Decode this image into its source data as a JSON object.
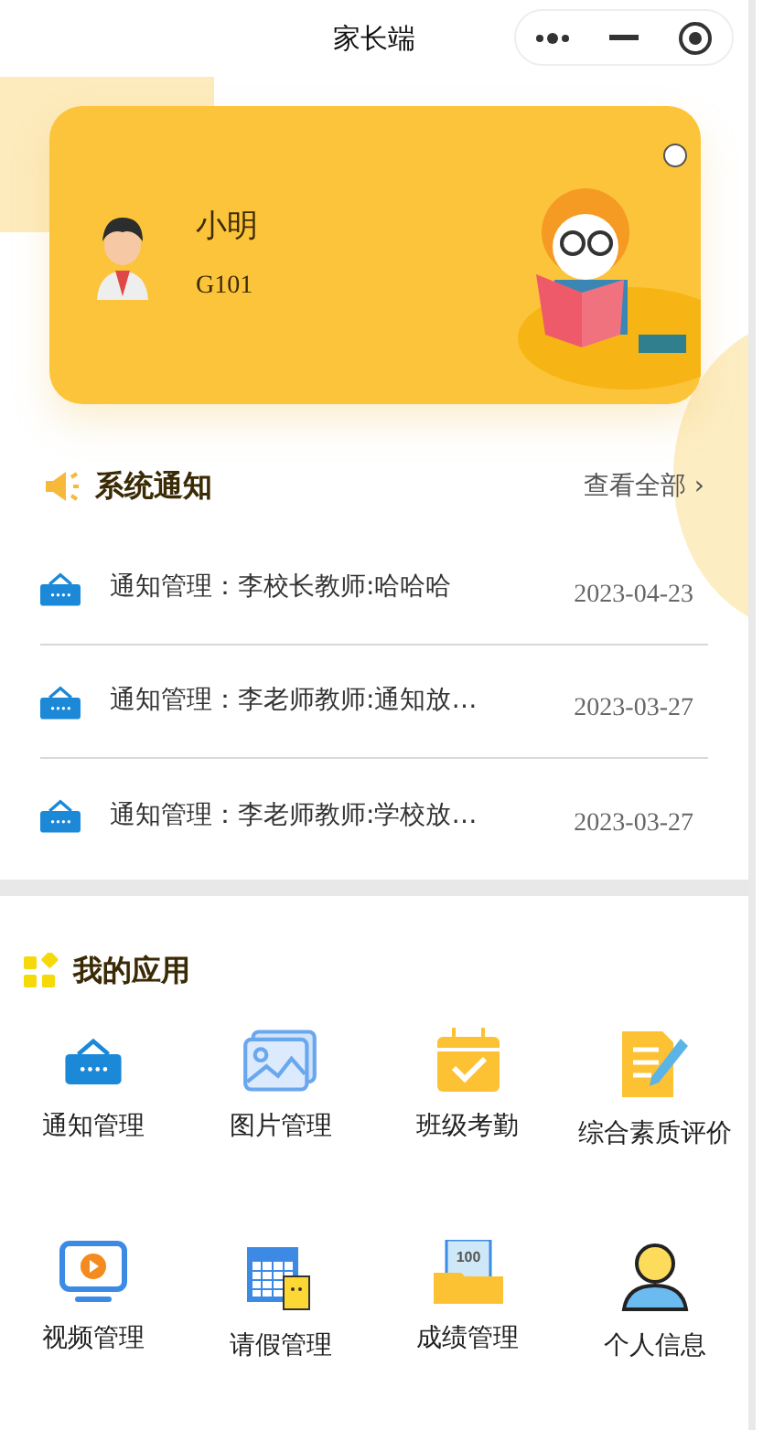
{
  "title_bar": {
    "title": "家长端"
  },
  "profile": {
    "name": "小明",
    "class_code": "G101"
  },
  "notices": {
    "title": "系统通知",
    "view_all": "查看全部",
    "chevron": "›",
    "items": [
      {
        "text": "通知管理：李校长教师:哈哈哈",
        "date": "2023-04-23"
      },
      {
        "text": "通知管理：李老师教师:通知放…",
        "date": "2023-03-27"
      },
      {
        "text": "通知管理：李老师教师:学校放…",
        "date": "2023-03-27"
      }
    ]
  },
  "apps": {
    "title": "我的应用",
    "items": [
      {
        "kind": "notice",
        "label": "通知管理"
      },
      {
        "kind": "picture",
        "label": "图片管理"
      },
      {
        "kind": "attendance",
        "label": "班级考勤"
      },
      {
        "kind": "evaluation",
        "label": "综合素质评价"
      },
      {
        "kind": "video",
        "label": "视频管理"
      },
      {
        "kind": "leave",
        "label": "请假管理"
      },
      {
        "kind": "grades",
        "label": "成绩管理",
        "icon_text": "100"
      },
      {
        "kind": "person",
        "label": "个人信息"
      }
    ]
  }
}
